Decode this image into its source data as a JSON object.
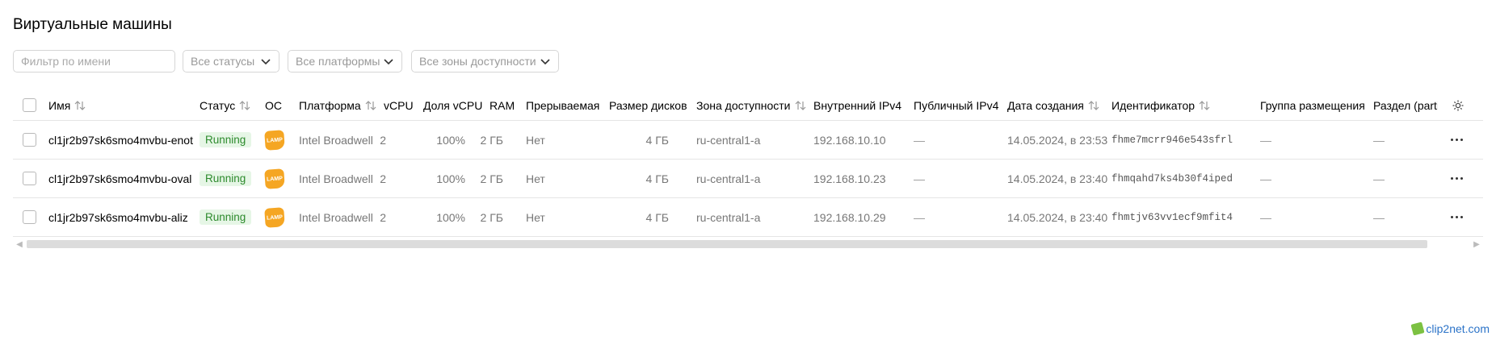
{
  "page": {
    "title": "Виртуальные машины"
  },
  "filters": {
    "name_placeholder": "Фильтр по имени",
    "status_select": "Все статусы",
    "platform_select": "Все платформы",
    "zone_select": "Все зоны доступности"
  },
  "table": {
    "headers": {
      "name": "Имя",
      "status": "Статус",
      "os": "ОС",
      "platform": "Платформа",
      "vcpu": "vCPU",
      "vcpu_share": "Доля vCPU",
      "ram": "RAM",
      "preemptible": "Прерываемая",
      "disk_size": "Размер дисков",
      "zone": "Зона доступности",
      "internal_ipv4": "Внутренний IPv4",
      "public_ipv4": "Публичный IPv4",
      "created": "Дата создания",
      "id": "Идентификатор",
      "placement_group": "Группа размещения",
      "partition": "Раздел (partitic"
    },
    "rows": [
      {
        "name": "cl1jr2b97sk6smo4mvbu-enot",
        "status": "Running",
        "os": "LAMP",
        "platform": "Intel Broadwell",
        "vcpu": "2",
        "vcpu_share": "100%",
        "ram": "2 ГБ",
        "preemptible": "Нет",
        "disk_size": "4 ГБ",
        "zone": "ru-central1-a",
        "internal_ipv4": "192.168.10.10",
        "public_ipv4": "—",
        "created": "14.05.2024, в 23:53",
        "id": "fhme7mcrr946e543sfrl",
        "placement_group": "—",
        "partition": "—"
      },
      {
        "name": "cl1jr2b97sk6smo4mvbu-oval",
        "status": "Running",
        "os": "LAMP",
        "platform": "Intel Broadwell",
        "vcpu": "2",
        "vcpu_share": "100%",
        "ram": "2 ГБ",
        "preemptible": "Нет",
        "disk_size": "4 ГБ",
        "zone": "ru-central1-a",
        "internal_ipv4": "192.168.10.23",
        "public_ipv4": "—",
        "created": "14.05.2024, в 23:40",
        "id": "fhmqahd7ks4b30f4iped",
        "placement_group": "—",
        "partition": "—"
      },
      {
        "name": "cl1jr2b97sk6smo4mvbu-aliz",
        "status": "Running",
        "os": "LAMP",
        "platform": "Intel Broadwell",
        "vcpu": "2",
        "vcpu_share": "100%",
        "ram": "2 ГБ",
        "preemptible": "Нет",
        "disk_size": "4 ГБ",
        "zone": "ru-central1-a",
        "internal_ipv4": "192.168.10.29",
        "public_ipv4": "—",
        "created": "14.05.2024, в 23:40",
        "id": "fhmtjv63vv1ecf9mfit4",
        "placement_group": "—",
        "partition": "—"
      }
    ]
  },
  "colors": {
    "running_bg": "#e6f6e6",
    "running_text": "#2c8a2c",
    "lamp_logo": "#f5a623"
  },
  "icons": {
    "sort": "sort-arrows-icon",
    "settings": "gear-icon",
    "more": "more-dots-icon",
    "chevron": "chevron-down-icon"
  },
  "watermark": "clip2net.com"
}
